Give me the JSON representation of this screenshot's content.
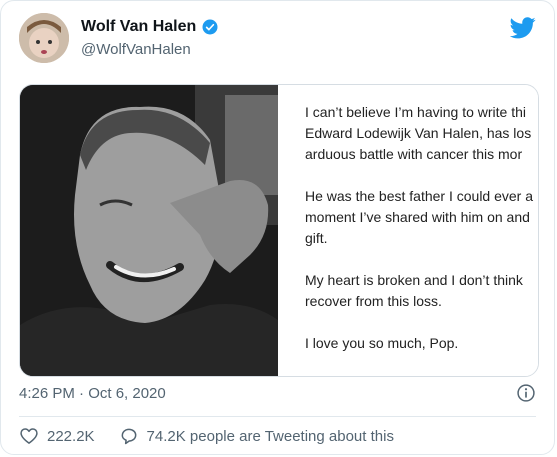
{
  "tweet": {
    "author": {
      "name": "Wolf Van Halen",
      "handle": "@WolfVanHalen",
      "verified": true
    },
    "note_lines": [
      {
        "id": "p1",
        "lines": [
          "I can’t believe I’m having to write thi",
          "Edward Lodewijk Van Halen, has los",
          "arduous battle with cancer this mor"
        ]
      },
      {
        "id": "p2",
        "lines": [
          "He was the best father I could ever a",
          "moment I’ve shared with him on and",
          "gift."
        ]
      },
      {
        "id": "p3",
        "lines": [
          "My heart is broken and I don’t think",
          "recover from this loss."
        ]
      },
      {
        "id": "p4",
        "lines": [
          "I love you so much, Pop."
        ]
      }
    ],
    "timestamp": "4:26 PM · Oct 6, 2020",
    "likes": "222.2K",
    "replies_text": "74.2K people are Tweeting about this"
  },
  "icons": {
    "verified": "verified-badge-icon",
    "brand": "twitter-bird-icon",
    "info": "info-icon",
    "like": "heart-icon",
    "reply": "speech-bubble-icon"
  },
  "colors": {
    "brand_blue": "#1d9bf0",
    "muted_text": "#536471",
    "border": "#e1e8ed"
  }
}
